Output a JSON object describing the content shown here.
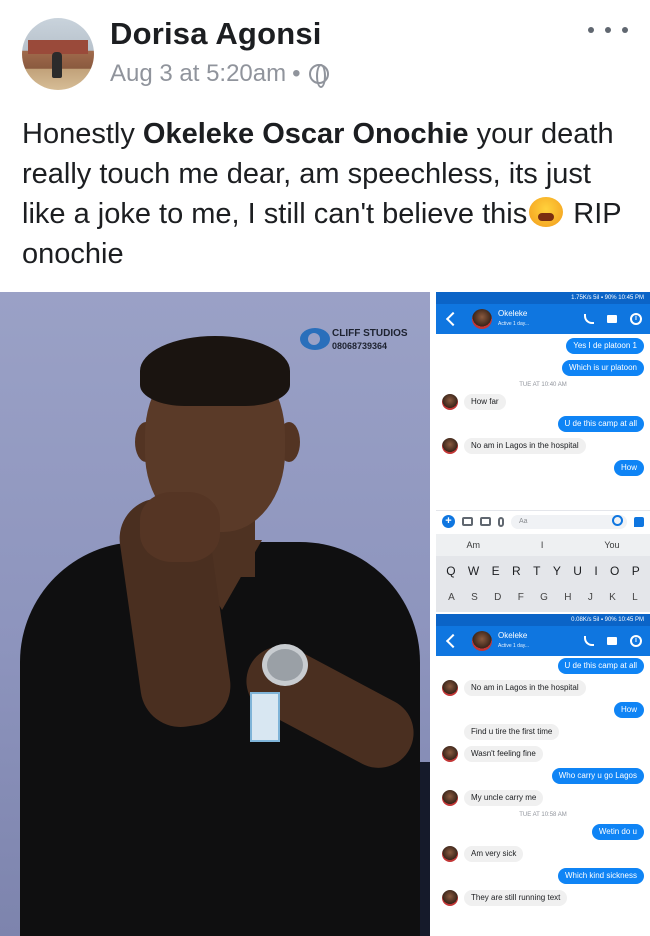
{
  "post": {
    "author": "Dorisa Agonsi",
    "timestamp": "Aug 3 at 5:20am",
    "separator": "•",
    "privacy_icon": "globe-icon",
    "more_icon": "more-options-icon",
    "text_before": "Honestly ",
    "tagged_name": "Okeleke Oscar Onochie",
    "text_after": " your death really touch me dear, am speechless, its just like a joke to me, I still can't believe this",
    "text_end": " RIP onochie",
    "emoji": "tired-face-emoji"
  },
  "photo": {
    "watermark_name": "CLIFF STUDIOS",
    "watermark_phone": "08068739364"
  },
  "chat1": {
    "status_left": "",
    "status_right": "1.75K/s 5il ▪ 90% 10:45 PM",
    "contact_name": "Okeleke",
    "contact_status": "Active 1 day...",
    "messages": [
      {
        "dir": "out",
        "text": "Yes I de platoon 1"
      },
      {
        "dir": "out",
        "text": "Which is ur platoon"
      },
      {
        "dir": "ts",
        "text": "TUE AT 10:40 AM"
      },
      {
        "dir": "in",
        "text": "How far"
      },
      {
        "dir": "out",
        "text": "U de this camp at all"
      },
      {
        "dir": "in",
        "text": "No am in Lagos in the hospital"
      },
      {
        "dir": "out",
        "text": "How"
      }
    ],
    "composer_placeholder": "Aa",
    "suggestions": [
      "Am",
      "I",
      "You"
    ],
    "keyboard_row1": [
      "Q",
      "W",
      "E",
      "R",
      "T",
      "Y",
      "U",
      "I",
      "O",
      "P"
    ],
    "keyboard_row2": [
      "A",
      "S",
      "D",
      "F",
      "G",
      "H",
      "J",
      "K",
      "L"
    ]
  },
  "chat2": {
    "status_right": "0.08K/s 5il ▪ 90% 10:45 PM",
    "contact_name": "Okeleke",
    "contact_status": "Active 1 day...",
    "messages": [
      {
        "dir": "out",
        "text": "U de this camp at all"
      },
      {
        "dir": "in",
        "text": "No am in Lagos in the hospital"
      },
      {
        "dir": "out",
        "text": "How"
      },
      {
        "dir": "in",
        "text": "Find u tire the first time"
      },
      {
        "dir": "in",
        "text": "Wasn't feeling fine"
      },
      {
        "dir": "out",
        "text": "Who carry u go Lagos"
      },
      {
        "dir": "in",
        "text": "My uncle carry me"
      },
      {
        "dir": "ts",
        "text": "TUE AT 10:58 AM"
      },
      {
        "dir": "out",
        "text": "Wetin do u"
      },
      {
        "dir": "in",
        "text": "Am very sick"
      },
      {
        "dir": "out",
        "text": "Which kind sickness"
      },
      {
        "dir": "in",
        "text": "They are still running text"
      }
    ]
  },
  "colors": {
    "messenger_blue": "#0f84f5",
    "app_bar": "#0f76e0",
    "meta_gray": "#90949c"
  }
}
